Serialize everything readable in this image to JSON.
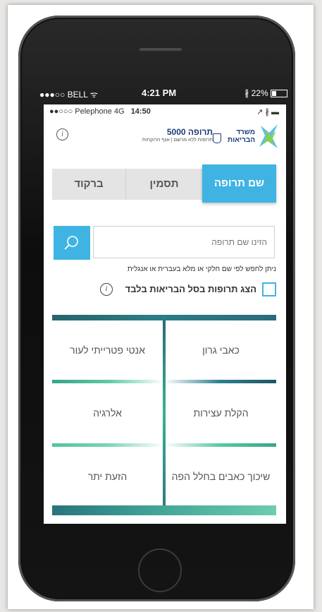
{
  "device_status": {
    "carrier": "●●●○○ BELL",
    "time": "4:21 PM",
    "battery": "22%"
  },
  "inner_status": {
    "carrier": "●●○○○ Pelephone 4G",
    "time": "14:50"
  },
  "header": {
    "app_name": "תרופה 5000",
    "app_subtitle": "תרופות ללא מרשם | אגף הרוקחות",
    "ministry_name": "משרד הבריאות"
  },
  "tabs": [
    {
      "label": "ברקוד"
    },
    {
      "label": "תסמין"
    },
    {
      "label": "שם תרופה"
    }
  ],
  "search": {
    "placeholder": "הזינו שם תרופה",
    "hint": "ניתן לחפש לפי שם חלקי או מלא בעברית או אנגלית"
  },
  "filter": {
    "label": "הצג תרופות בסל הבריאות בלבד"
  },
  "symptoms": [
    {
      "label": "כאבי גרון"
    },
    {
      "label": "אנטי פטרייתי לעור"
    },
    {
      "label": "הקלת עצירות"
    },
    {
      "label": "אלרגיה"
    },
    {
      "label": "שיכוך כאבים בחלל הפה"
    },
    {
      "label": "הזעת יתר"
    }
  ],
  "colors": {
    "accent": "#3fb4e3",
    "brand": "#1b3c73",
    "teal": "#2a7d86"
  },
  "icons": {
    "search": "search-icon",
    "info": "info-icon",
    "wifi": "wifi-icon",
    "battery": "battery-icon"
  }
}
